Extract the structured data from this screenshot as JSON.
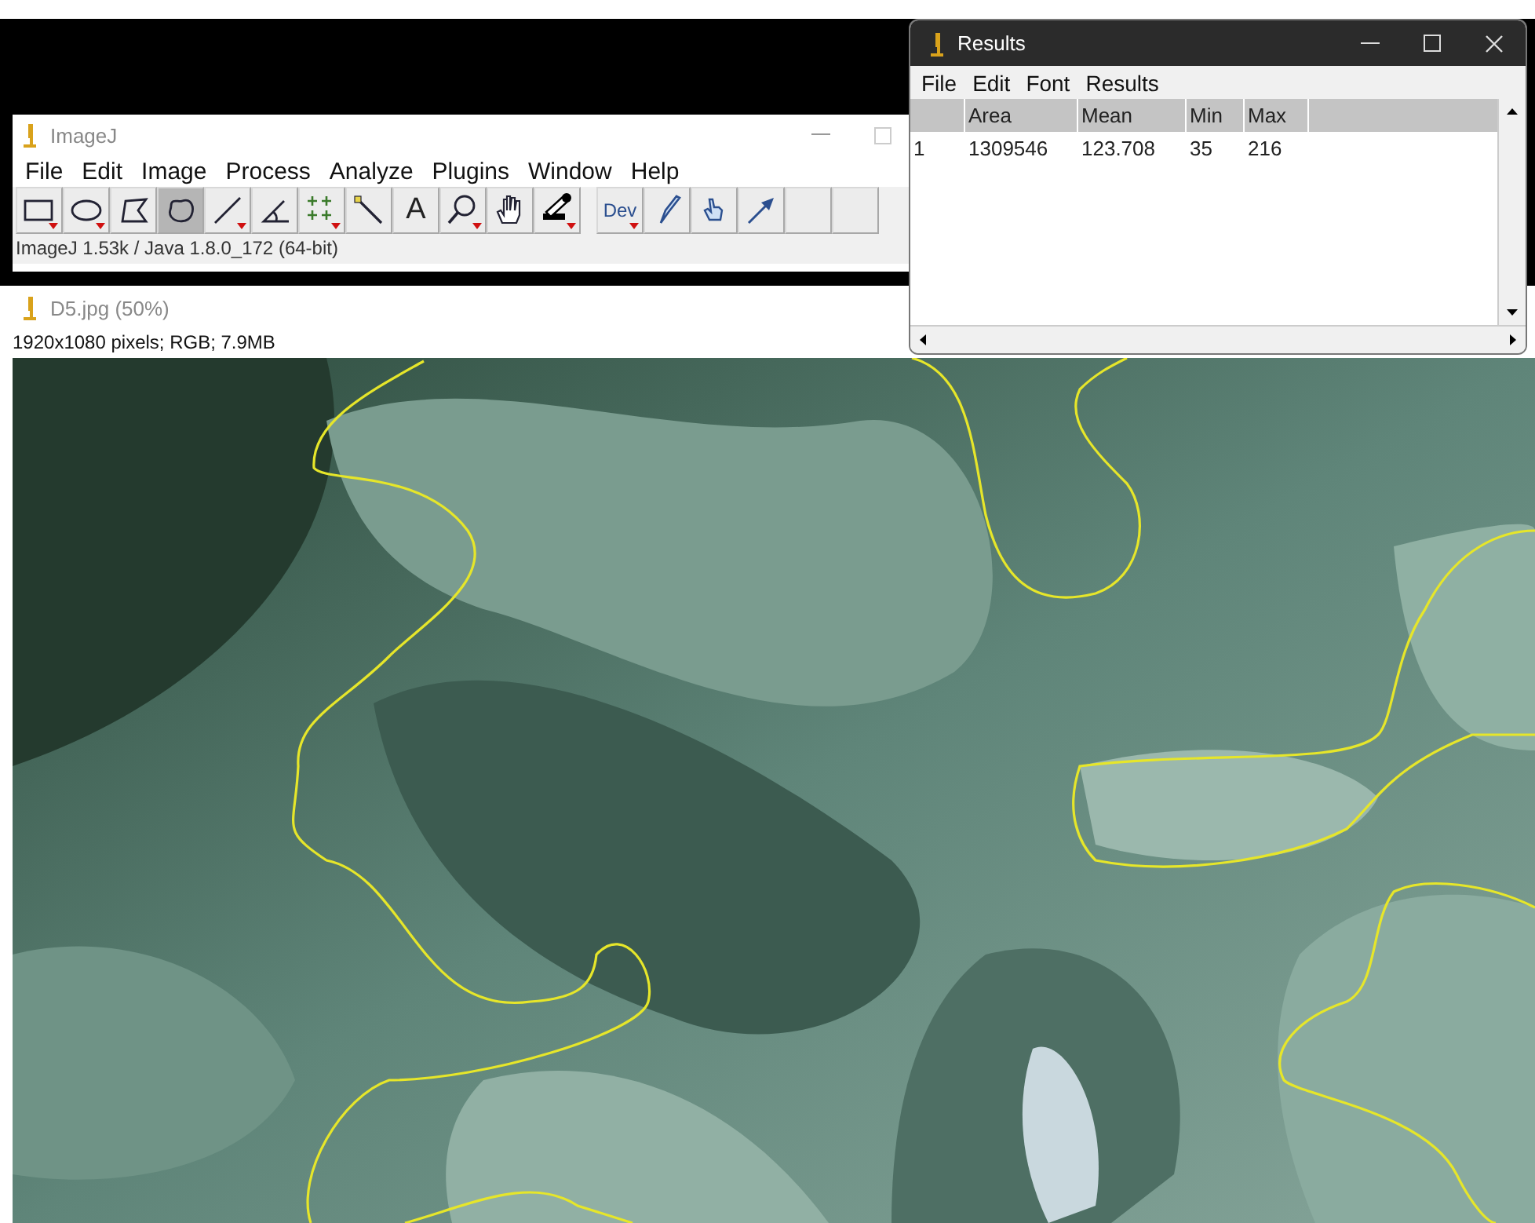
{
  "imagej": {
    "title": "ImageJ",
    "menu": [
      "File",
      "Edit",
      "Image",
      "Process",
      "Analyze",
      "Plugins",
      "Window",
      "Help"
    ],
    "tools": [
      {
        "kind": "rectangle",
        "selected": false,
        "menu": true
      },
      {
        "kind": "oval",
        "selected": false,
        "menu": true
      },
      {
        "kind": "polygon",
        "selected": false,
        "menu": false
      },
      {
        "kind": "freehand",
        "selected": true,
        "menu": false
      },
      {
        "kind": "line",
        "selected": false,
        "menu": true
      },
      {
        "kind": "angle",
        "selected": false,
        "menu": false
      },
      {
        "kind": "points",
        "selected": false,
        "menu": true
      },
      {
        "kind": "wand",
        "selected": false,
        "menu": false
      },
      {
        "kind": "text",
        "label": "A",
        "selected": false,
        "menu": false
      },
      {
        "kind": "magnifier",
        "selected": false,
        "menu": true
      },
      {
        "kind": "hand",
        "selected": false,
        "menu": false
      },
      {
        "kind": "dropper",
        "selected": false,
        "menu": true
      },
      {
        "kind": "label",
        "label": "Dev",
        "selected": false,
        "menu": true
      },
      {
        "kind": "brush",
        "selected": false,
        "menu": false
      },
      {
        "kind": "pointer",
        "selected": false,
        "menu": false
      },
      {
        "kind": "arrow",
        "selected": false,
        "menu": false
      },
      {
        "kind": "empty",
        "selected": false,
        "menu": false
      },
      {
        "kind": "empty",
        "selected": false,
        "menu": false
      }
    ],
    "status": "ImageJ 1.53k / Java 1.8.0_172 (64-bit)"
  },
  "image_window": {
    "title": "D5.jpg (50%)",
    "info": "1920x1080 pixels; RGB; 7.9MB"
  },
  "results": {
    "title": "Results",
    "menu": [
      "File",
      "Edit",
      "Font",
      "Results"
    ],
    "columns": [
      "",
      "Area",
      "Mean",
      "Min",
      "Max"
    ],
    "rows": [
      [
        "1",
        "1309546",
        "123.708",
        "35",
        "216"
      ]
    ]
  }
}
